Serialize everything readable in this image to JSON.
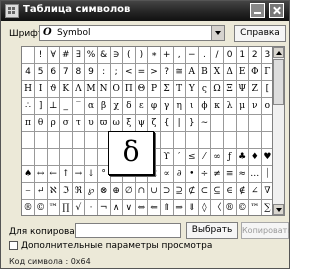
{
  "window": {
    "title": "Таблица символов"
  },
  "font": {
    "label": "Шрифт:",
    "icon": "open-type-icon",
    "icon_glyph": "O",
    "value": "Symbol"
  },
  "help_button": "Справка",
  "grid": {
    "rows": [
      [
        " ",
        "!",
        "∀",
        "#",
        "∃",
        "%",
        "&",
        "∋",
        "(",
        ")",
        "∗",
        "+",
        ",",
        "−",
        ".",
        "/",
        "0",
        "1",
        "2",
        "3"
      ],
      [
        "4",
        "5",
        "6",
        "7",
        "8",
        "9",
        ":",
        ";",
        "<",
        "=",
        ">",
        "?",
        "≅",
        "Α",
        "Β",
        "Χ",
        "Δ",
        "Ε",
        "Φ",
        "Γ"
      ],
      [
        "Η",
        "Ι",
        "ϑ",
        "Κ",
        "Λ",
        "Μ",
        "Ν",
        "Ο",
        "Π",
        "Θ",
        "Ρ",
        "Σ",
        "Τ",
        "Υ",
        "ς",
        "Ω",
        "Ξ",
        "Ψ",
        "Ζ",
        "["
      ],
      [
        "∴",
        "]",
        "⊥",
        "_",
        "‾",
        "α",
        "β",
        "χ",
        "δ",
        "ε",
        "φ",
        "γ",
        "η",
        "ι",
        "ϕ",
        "κ",
        "λ",
        "μ",
        "ν",
        "ο"
      ],
      [
        "π",
        "θ",
        "ρ",
        "σ",
        "τ",
        "υ",
        "ϖ",
        "ω",
        "ξ",
        "ψ",
        "ζ",
        "{",
        "|",
        "}",
        "∼",
        "",
        "",
        "",
        "",
        ""
      ],
      [
        "",
        "",
        "",
        "",
        "",
        "",
        "",
        "",
        "",
        "",
        "",
        "",
        "",
        "",
        "",
        "",
        "",
        "",
        "",
        ""
      ],
      [
        "",
        "",
        "",
        "",
        "",
        "",
        "",
        "",
        "",
        "",
        "",
        "ϒ",
        "′",
        "≤",
        "⁄",
        "∞",
        "ƒ",
        "♣",
        "♦",
        "♥"
      ],
      [
        "♠",
        "↔",
        "←",
        "↑",
        "→",
        "↓",
        "°",
        "±",
        "″",
        "≥",
        "×",
        "∝",
        "∂",
        "•",
        "÷",
        "≠",
        "≡",
        "≈",
        "…",
        "⏐"
      ],
      [
        "⎯",
        "↵",
        "ℵ",
        "ℑ",
        "ℜ",
        "℘",
        "⊗",
        "⊕",
        "∅",
        "∩",
        "∪",
        "⊃",
        "⊇",
        "⊄",
        "⊂",
        "⊆",
        "∈",
        "∉",
        "∠",
        "∇"
      ],
      [
        "®",
        "©",
        "™",
        "∏",
        "√",
        "⋅",
        "¬",
        "∧",
        "∨",
        "⇔",
        "⇐",
        "⇑",
        "⇒",
        "⇓",
        "◊",
        "〈",
        "®",
        "©",
        "™",
        "∑"
      ]
    ],
    "zoom_glyph": "δ"
  },
  "copy": {
    "label": "Для копирования:",
    "value": "",
    "select_button": "Выбрать",
    "copy_button": "Копировать"
  },
  "advanced_view": {
    "label": "Дополнительные параметры просмотра",
    "checked": false
  },
  "status": "Код символа : 0x64"
}
